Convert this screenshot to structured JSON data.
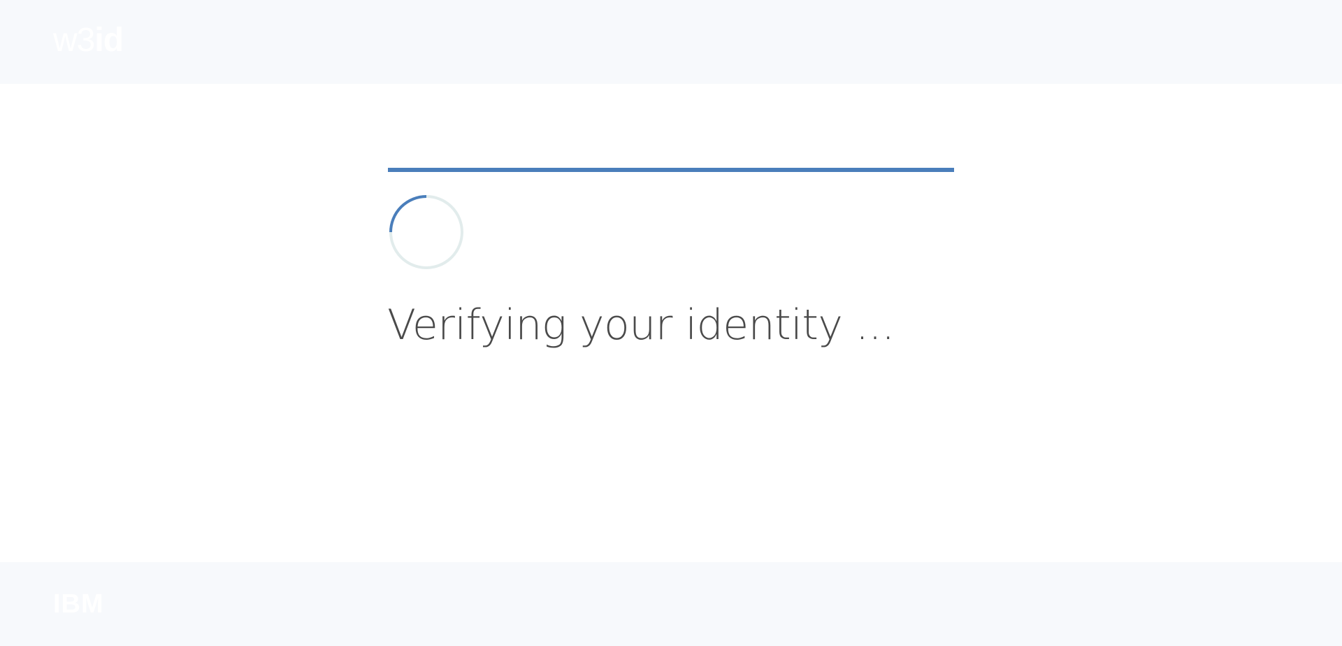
{
  "header": {
    "logo_light": "w3",
    "logo_bold": "id"
  },
  "main": {
    "status_text": "Verifying your identity ..."
  },
  "footer": {
    "brand": "IBM"
  },
  "colors": {
    "accent": "#4a7ebb",
    "chrome_bg": "#f7f9fc",
    "text": "#4a4a4a",
    "spinner_track": "#e2ecec"
  },
  "icons": {
    "loading": "loading-spinner-icon"
  }
}
